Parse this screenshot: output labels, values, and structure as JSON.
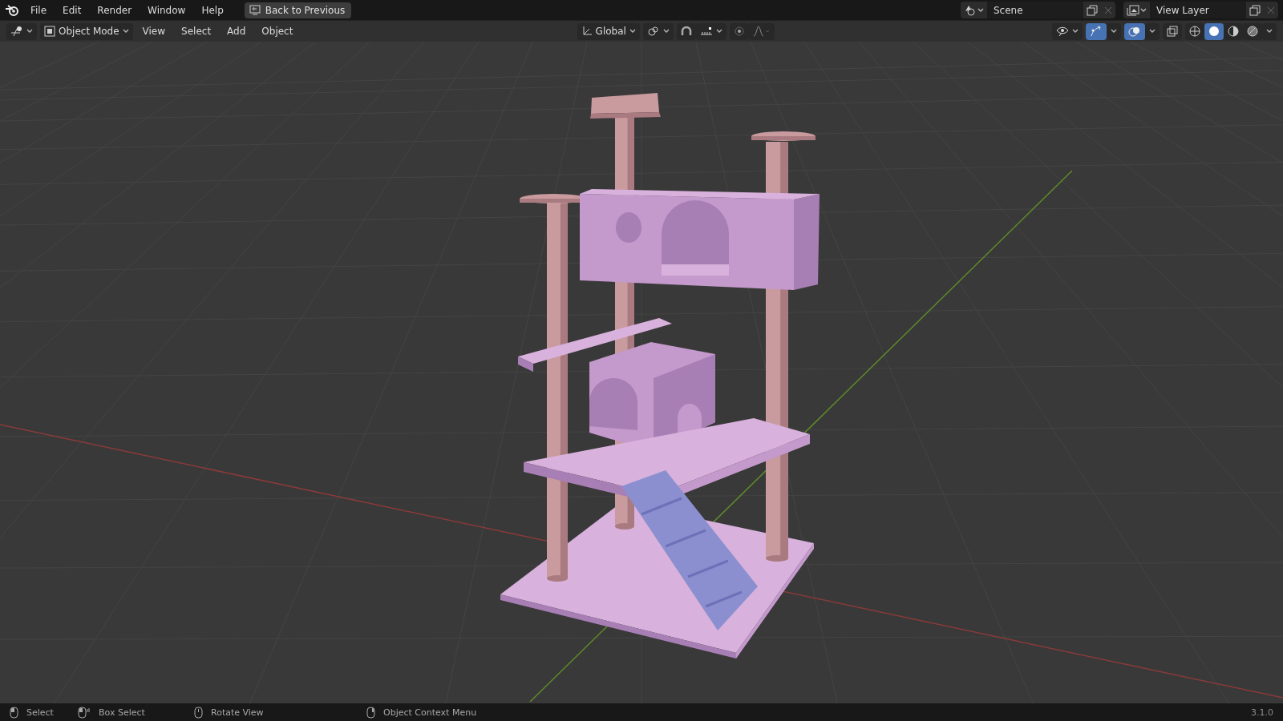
{
  "top_bar": {
    "menus": [
      "File",
      "Edit",
      "Render",
      "Window",
      "Help"
    ],
    "back_button": "Back to Previous",
    "scene": "Scene",
    "view_layer": "View Layer"
  },
  "header": {
    "mode": "Object Mode",
    "menus": [
      "View",
      "Select",
      "Add",
      "Object"
    ],
    "orientation": "Global",
    "snap_on": false,
    "proportional_on": false,
    "gizmo_on": true,
    "overlay_on": true,
    "shading": [
      {
        "kind": "wireframe",
        "selected": false
      },
      {
        "kind": "solid",
        "selected": true
      },
      {
        "kind": "material",
        "selected": false
      },
      {
        "kind": "rendered",
        "selected": false
      }
    ]
  },
  "status_bar": {
    "items": [
      {
        "kind": "left",
        "label": "Select"
      },
      {
        "kind": "drag",
        "label": "Box Select"
      },
      {
        "kind": "middle",
        "label": "Rotate View"
      },
      {
        "kind": "right",
        "label": "Object Context Menu"
      }
    ],
    "version": "3.1.0"
  }
}
